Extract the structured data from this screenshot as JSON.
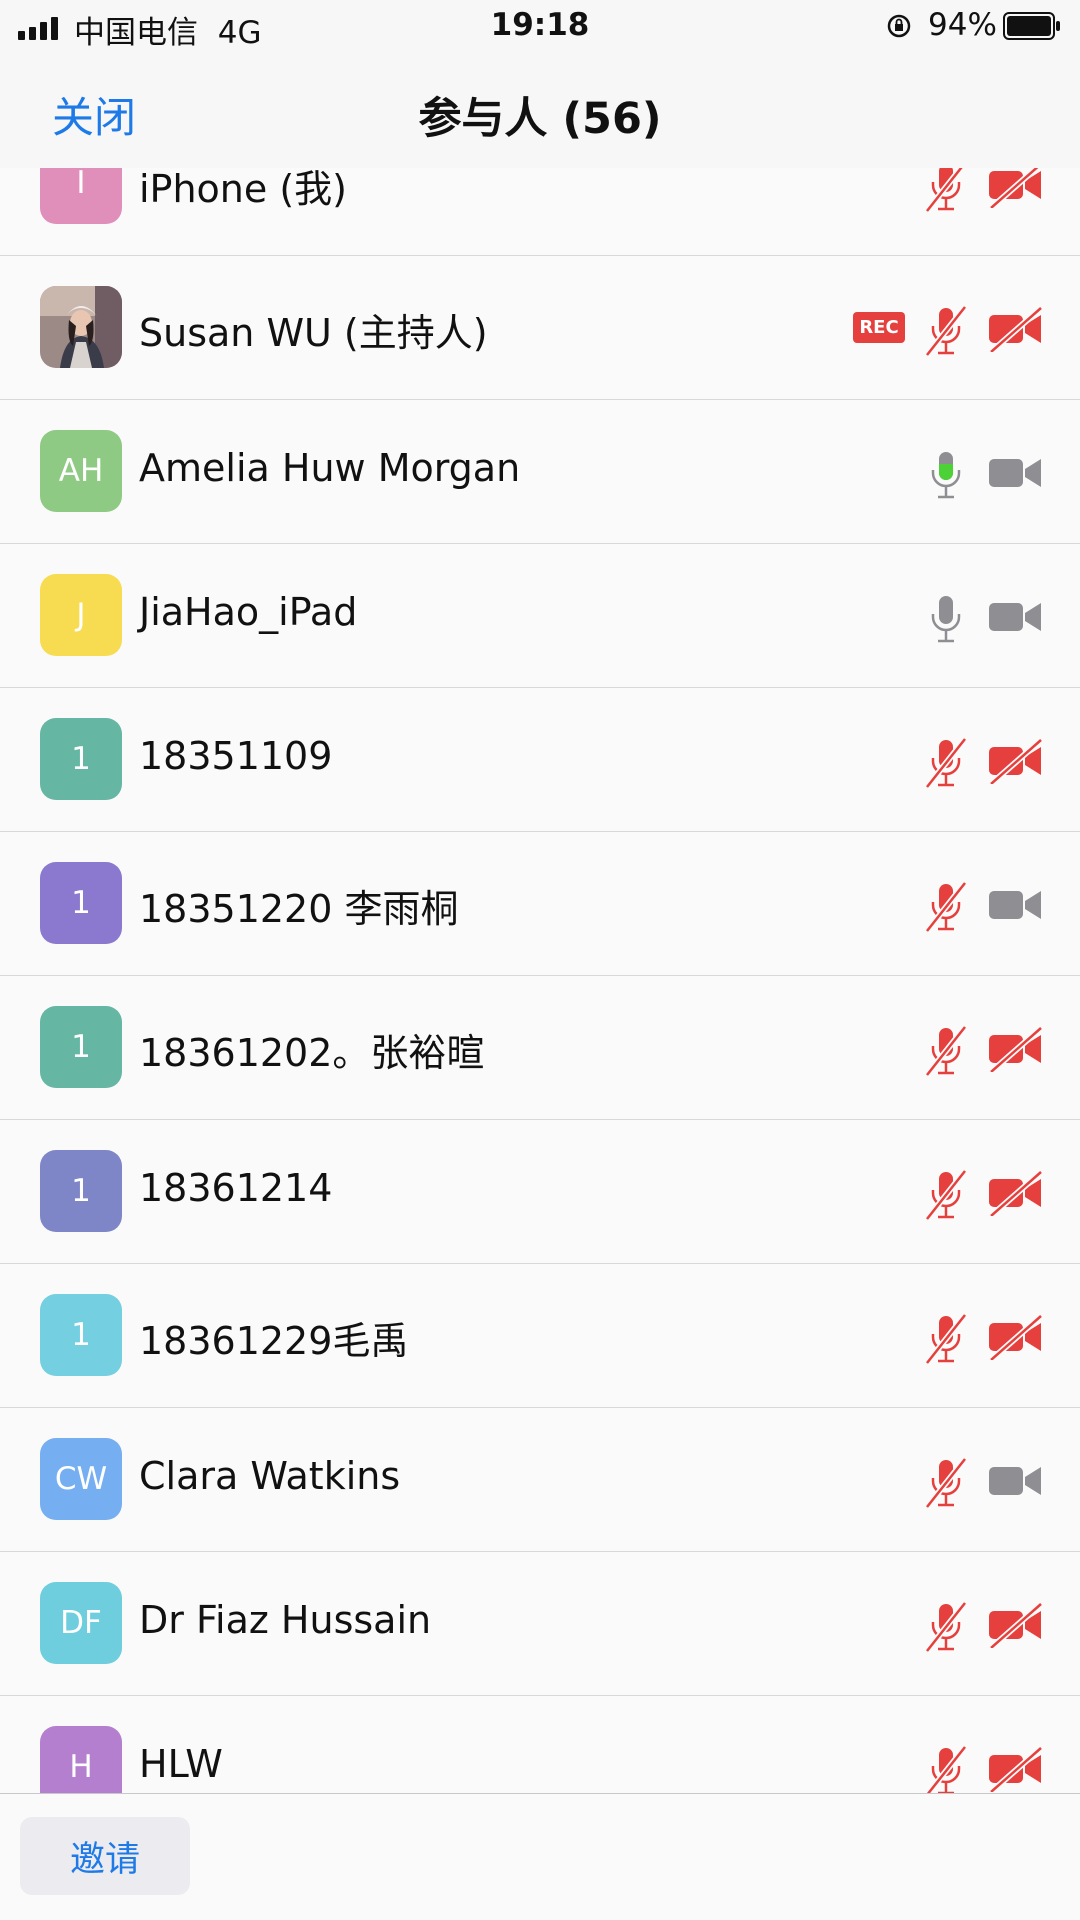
{
  "status_bar": {
    "carrier": "中国电信",
    "network": "4G",
    "time": "19:18",
    "battery": "94%"
  },
  "nav": {
    "close_label": "关闭",
    "title": "参与人 (56)"
  },
  "participants": [
    {
      "initials": "I",
      "color": "#e08fbb",
      "name": "iPhone (我)",
      "mic": "muted",
      "video": "off",
      "rec": false
    },
    {
      "initials": "",
      "photo": true,
      "name": "Susan WU (主持人)",
      "mic": "muted",
      "video": "off",
      "rec": true,
      "rec_label": "REC"
    },
    {
      "initials": "AH",
      "color": "#8fca84",
      "name": "Amelia Huw Morgan",
      "mic": "speaking",
      "video": "inactive",
      "rec": false
    },
    {
      "initials": "J",
      "color": "#f7dc52",
      "name": "JiaHao_iPad",
      "mic": "inactive",
      "video": "inactive",
      "rec": false
    },
    {
      "initials": "1",
      "color": "#66b6a4",
      "name": "18351109",
      "mic": "muted",
      "video": "off",
      "rec": false
    },
    {
      "initials": "1",
      "color": "#8b79cf",
      "name": "18351220 李雨桐",
      "mic": "muted",
      "video": "inactive",
      "rec": false
    },
    {
      "initials": "1",
      "color": "#66b6a4",
      "name": "18361202。张裕暄",
      "mic": "muted",
      "video": "off",
      "rec": false
    },
    {
      "initials": "1",
      "color": "#7f86c8",
      "name": "18361214",
      "mic": "muted",
      "video": "off",
      "rec": false
    },
    {
      "initials": "1",
      "color": "#74cfe0",
      "name": "18361229毛禹",
      "mic": "muted",
      "video": "off",
      "rec": false
    },
    {
      "initials": "CW",
      "color": "#76aef2",
      "name": "Clara Watkins",
      "mic": "muted",
      "video": "inactive",
      "rec": false
    },
    {
      "initials": "DF",
      "color": "#6fcede",
      "name": "Dr Fiaz Hussain",
      "mic": "muted",
      "video": "off",
      "rec": false
    },
    {
      "initials": "H",
      "color": "#b57fcf",
      "name": "HLW",
      "mic": "muted",
      "video": "off",
      "rec": false
    }
  ],
  "icons": {
    "mic_muted": "mic-muted-icon",
    "mic_speaking": "mic-speaking-icon",
    "mic_inactive": "mic-icon",
    "video_off": "video-off-icon",
    "video_inactive": "video-icon"
  },
  "colors": {
    "accent": "#1e7ae6",
    "muted_red": "#e5403d",
    "inactive_gray": "#8e8e93",
    "speaking_green": "#4cd137"
  },
  "footer": {
    "invite_label": "邀请"
  }
}
